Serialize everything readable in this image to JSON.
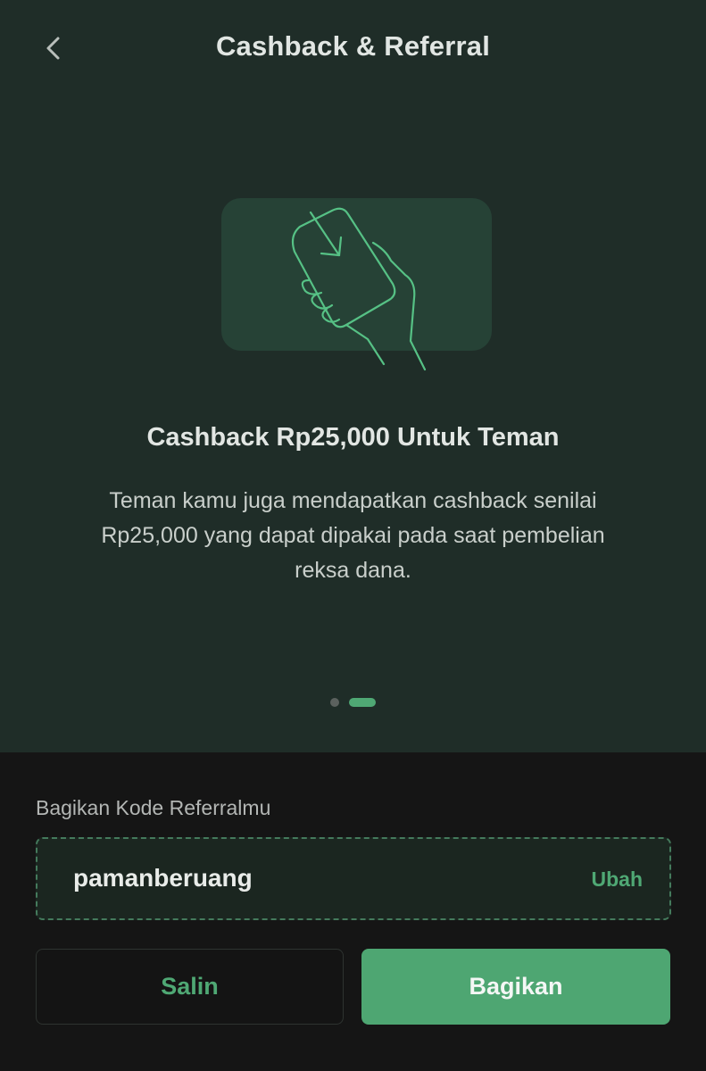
{
  "header": {
    "title": "Cashback & Referral",
    "back_icon": "chevron-left-icon"
  },
  "carousel": {
    "illustration": "hand-holding-phone-icon",
    "title": "Cashback Rp25,000 Untuk Teman",
    "description": "Teman kamu juga mendapatkan cashback senilai Rp25,000 yang dapat dipakai pada saat pembelian reksa dana.",
    "total_slides": 2,
    "active_slide": 2
  },
  "referral": {
    "label": "Bagikan Kode Referralmu",
    "code": "pamanberuang",
    "change_label": "Ubah"
  },
  "actions": {
    "copy_label": "Salin",
    "share_label": "Bagikan"
  },
  "colors": {
    "accent": "#4fa874",
    "top_background": "#1f2d28",
    "bottom_background": "#151515"
  }
}
